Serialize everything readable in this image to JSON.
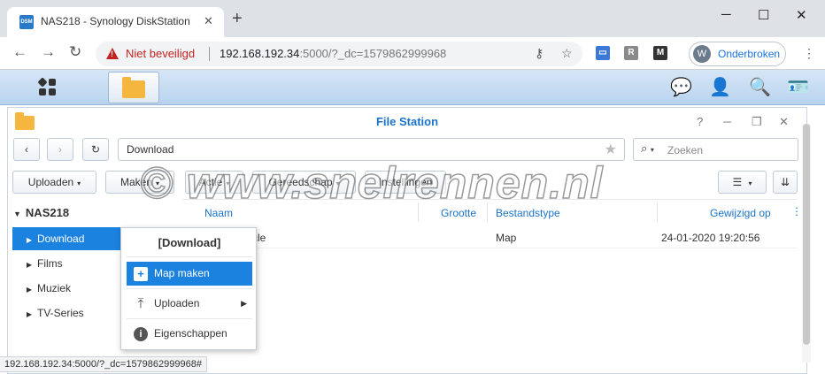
{
  "browser": {
    "tab_title": "NAS218 - Synology DiskStation",
    "tab_favicon_text": "DSM",
    "new_tab": "+",
    "security_label": "Niet beveiligd",
    "url_host": "192.168.192.34",
    "url_rest": ":5000/?_dc=1579862999968",
    "profile_initial": "W",
    "profile_label": "Onderbroken",
    "ext_r": "R",
    "ext_m": "M"
  },
  "dsm": {
    "window_title": "File Station"
  },
  "filestation": {
    "path": "Download",
    "search_placeholder": "Zoeken",
    "buttons": {
      "upload": "Uploaden",
      "create": "Maken",
      "action": "Actie",
      "tools": "Gereedschap",
      "settings": "Instellingen"
    },
    "tree": {
      "root": "NAS218",
      "items": [
        {
          "label": "Download"
        },
        {
          "label": "Films"
        },
        {
          "label": "Muziek"
        },
        {
          "label": "TV-Series"
        }
      ]
    },
    "columns": {
      "name": "Naam",
      "size": "Grootte",
      "type": "Bestandstype",
      "modified": "Gewijzigd op"
    },
    "rows": [
      {
        "name": "cle",
        "type": "Map",
        "modified": "24-01-2020 19:20:56"
      }
    ]
  },
  "context_menu": {
    "title": "[Download]",
    "items": [
      {
        "label": "Map maken"
      },
      {
        "label": "Uploaden"
      },
      {
        "label": "Eigenschappen"
      }
    ]
  },
  "watermark": "© www.snelrennen.nl",
  "status_url": "192.168.192.34:5000/?_dc=1579862999968#",
  "colors": {
    "accent": "#1b82e0",
    "title_blue": "#1a73c8",
    "insecure_red": "#c5221f"
  }
}
